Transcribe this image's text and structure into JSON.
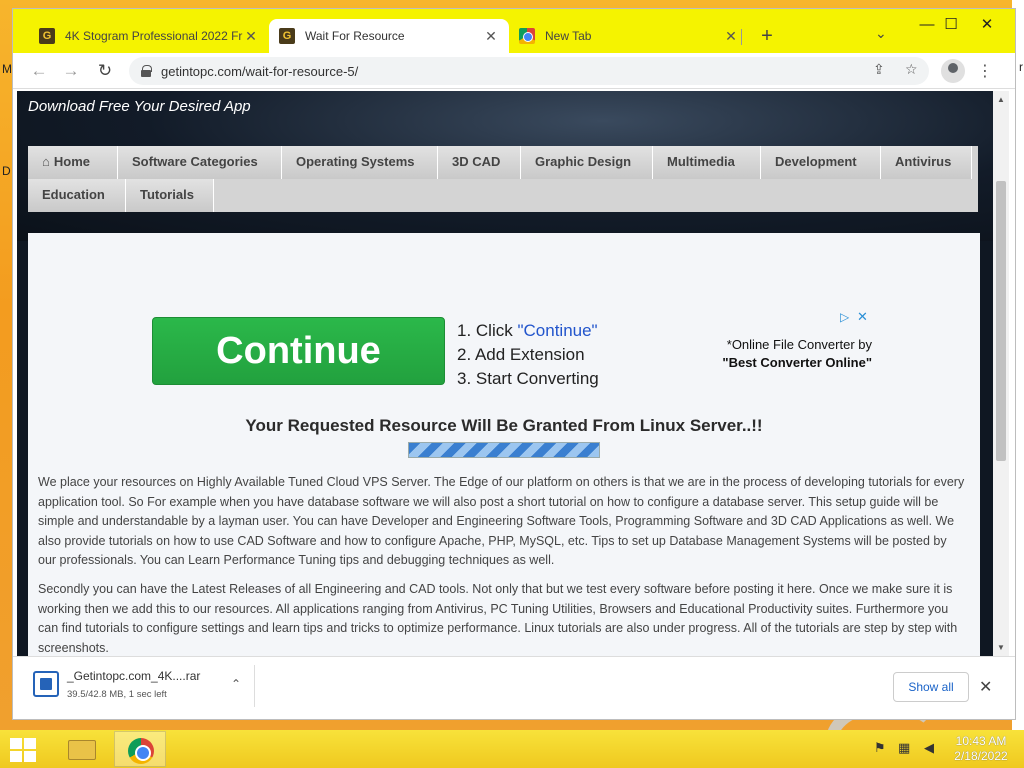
{
  "desktop": {
    "left_letters": [
      "M",
      "D"
    ],
    "right_letter": "r"
  },
  "window_controls": {
    "minimize": "—",
    "maximize": "☐",
    "close": "✕"
  },
  "tabs": [
    {
      "label": "4K Stogram Professional 2022 Fr",
      "close": "✕",
      "favicon": "G"
    },
    {
      "label": "Wait For Resource",
      "close": "✕",
      "favicon": "G"
    },
    {
      "label": "New Tab",
      "close": "✕"
    }
  ],
  "new_tab": "+",
  "tab_dropdown": "⌄",
  "toolbar": {
    "back": "←",
    "forward": "→",
    "reload": "↻",
    "url": "getintopc.com/wait-for-resource-5/",
    "share": "⇪",
    "bookmark": "☆",
    "menu": "⋮"
  },
  "page": {
    "tagline": "Download Free Your Desired App",
    "menu": {
      "home": "Home",
      "items": [
        "Software Categories",
        "Operating Systems",
        "3D CAD",
        "Graphic Design",
        "Multimedia",
        "Development",
        "Antivirus",
        "Education",
        "Tutorials"
      ]
    },
    "ad": {
      "button": "Continue",
      "step1_prefix": "1. Click ",
      "step1_link": "\"Continue\"",
      "step2": "2. Add Extension",
      "step3": "3. Start Converting",
      "note_line1": "*Online File Converter by",
      "note_line2": "\"Best Converter Online\"",
      "info_icon": "▷",
      "close_icon": "✕"
    },
    "granted": "Your Requested Resource Will Be Granted From Linux Server..!!",
    "paragraphs": [
      "We place your resources on Highly Available Tuned Cloud VPS Server. The Edge of our platform on others is that we are in the process of developing tutorials for every application tool. So For example when you have database software we will also post a short tutorial on how to configure a database server. This setup guide will be simple and understandable by a layman user. You can have Developer and Engineering Software Tools, Programming Software and 3D CAD Applications as well. We also provide tutorials on how to use CAD Software and how to configure Apache, PHP, MySQL, etc. Tips to set up Database Management Systems will be posted by our professionals. You can Learn Performance Tuning tips and debugging techniques as well.",
      "Secondly you can have the Latest Releases of all Engineering and CAD tools. Not only that but we test every software before posting it here. Once we make sure it is working then we add this to our resources. All applications ranging from Antivirus, PC Tuning Utilities, Browsers and Educational Productivity suites. Furthermore you can find tutorials to configure settings and learn tips and tricks to optimize performance. Linux tutorials are also under progress. All of the tutorials are step by step with screenshots."
    ]
  },
  "scrollbar": {
    "up": "▲",
    "down": "▼"
  },
  "download": {
    "filename": "_Getintopc.com_4K....rar",
    "status": "39.5/42.8 MB, 1 sec left",
    "chevron": "⌃",
    "show_all": "Show all",
    "close": "✕"
  },
  "taskbar": {
    "time": "10:43 AM",
    "date": "2/18/2022"
  }
}
